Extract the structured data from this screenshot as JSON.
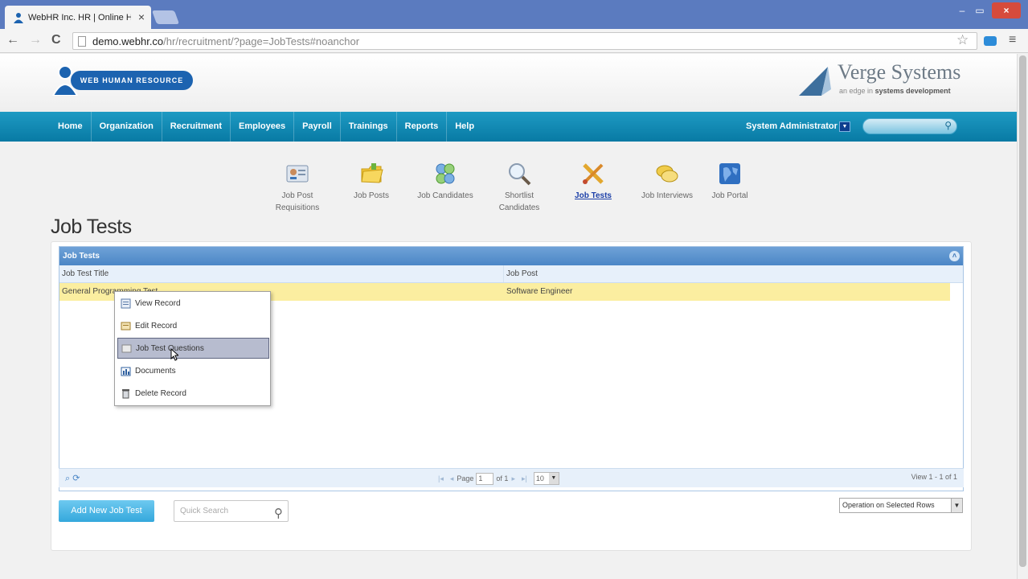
{
  "browser": {
    "tab_title": "WebHR Inc. HR | Online H",
    "tab_close": "×",
    "url_host": "demo.webhr.co",
    "url_path": "/hr/recruitment/?page=JobTests#noanchor",
    "back": "←",
    "forward": "→",
    "reload": "C",
    "star": "☆",
    "menu": "≡",
    "minimize": "–",
    "maximize": "▭",
    "close": "×"
  },
  "header": {
    "logo_text": "WEB HUMAN RESOURCE",
    "company_name": "Verge Systems",
    "company_tag_prefix": "an edge in",
    "company_tag_bold": "systems development"
  },
  "mainnav": {
    "items": [
      "Home",
      "Organization",
      "Recruitment",
      "Employees",
      "Payroll",
      "Trainings",
      "Reports",
      "Help"
    ],
    "user": "System Administrator",
    "user_dropdown": "▼",
    "search_icon": "⚲"
  },
  "modules": [
    {
      "label": "Job Post Requisitions",
      "icon": "id-card-icon"
    },
    {
      "label": "Job Posts",
      "icon": "folder-icon"
    },
    {
      "label": "Job Candidates",
      "icon": "people-icon"
    },
    {
      "label": "Shortlist Candidates",
      "icon": "magnifier-icon"
    },
    {
      "label": "Job Tests",
      "icon": "tools-icon",
      "active": true
    },
    {
      "label": "Job Interviews",
      "icon": "chat-icon"
    },
    {
      "label": "Job Portal",
      "icon": "globe-icon"
    }
  ],
  "page_title": "Job Tests",
  "grid": {
    "caption": "Job Tests",
    "collapse": "˄",
    "columns": [
      "Job Test Title",
      "Job Post"
    ],
    "rows": [
      {
        "title": "General Programming Test",
        "post": "Software Engineer"
      }
    ],
    "pager": {
      "tools": "⌕ ⟳",
      "first": "|◂",
      "prev": "◂",
      "page_label": "Page",
      "page": "1",
      "of_label": "of 1",
      "next": "▸",
      "last": "▸|",
      "page_size": "10",
      "size_btn": "▼",
      "view": "View 1 - 1 of 1"
    }
  },
  "actions": {
    "add_button": "Add New Job Test",
    "quick_search_placeholder": "Quick Search",
    "quick_search_icon": "⚲",
    "operation_select": "Operation on Selected Rows",
    "operation_btn": "▼"
  },
  "context_menu": {
    "items": [
      {
        "label": "View Record",
        "icon": "view-icon"
      },
      {
        "label": "Edit Record",
        "icon": "edit-icon"
      },
      {
        "label": "Job Test Questions",
        "icon": "questions-icon",
        "hover": true
      },
      {
        "label": "Documents",
        "icon": "documents-icon"
      },
      {
        "label": "Delete Record",
        "icon": "delete-icon"
      }
    ]
  },
  "colors": {
    "nav": "#0d86b2",
    "grid_caption": "#5892cf",
    "selected_row": "#fbeea0",
    "add_button": "#4bb4e4",
    "active_module": "#1c3fa8"
  }
}
